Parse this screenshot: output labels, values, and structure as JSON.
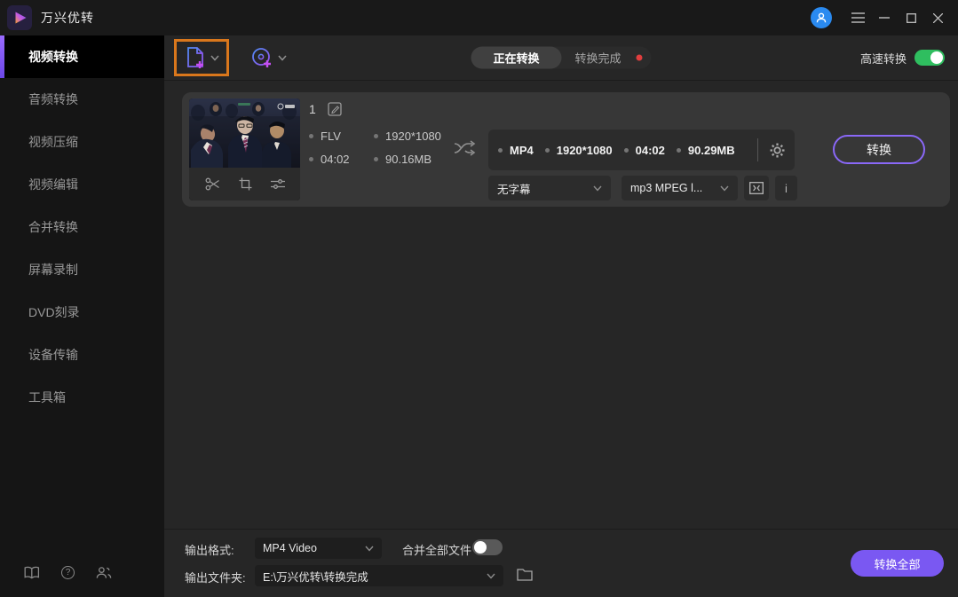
{
  "titlebar": {
    "app_title": "万兴优转"
  },
  "sidebar": {
    "items": [
      {
        "label": "视频转换"
      },
      {
        "label": "音频转换"
      },
      {
        "label": "视频压缩"
      },
      {
        "label": "视频编辑"
      },
      {
        "label": "合并转换"
      },
      {
        "label": "屏幕录制"
      },
      {
        "label": "DVD刻录"
      },
      {
        "label": "设备传输"
      },
      {
        "label": "工具箱"
      }
    ]
  },
  "toolbar": {
    "tab_converting": "正在转换",
    "tab_finished": "转换完成",
    "fast_convert_label": "高速转换",
    "fast_convert_on": true
  },
  "task": {
    "index": "1",
    "source": {
      "format": "FLV",
      "resolution": "1920*1080",
      "duration": "04:02",
      "size": "90.16MB"
    },
    "output": {
      "format": "MP4",
      "resolution": "1920*1080",
      "duration": "04:02",
      "size": "90.29MB"
    },
    "subtitle_select": "无字幕",
    "audio_select": "mp3 MPEG l...",
    "convert_button": "转换"
  },
  "footer": {
    "format_label": "输出格式:",
    "format_value": "MP4 Video",
    "merge_label": "合并全部文件",
    "merge_on": false,
    "folder_label": "输出文件夹:",
    "folder_value": "E:\\万兴优转\\转换完成",
    "convert_all_button": "转换全部"
  },
  "icons": {
    "info": "i",
    "question": "?"
  },
  "colors": {
    "accent_purple": "#7b5cf6",
    "highlight_orange": "#d9771c",
    "toggle_green": "#2fbe5f",
    "badge_red": "#e03e3e",
    "avatar_blue": "#2a8af0",
    "card_bg": "#373737"
  }
}
